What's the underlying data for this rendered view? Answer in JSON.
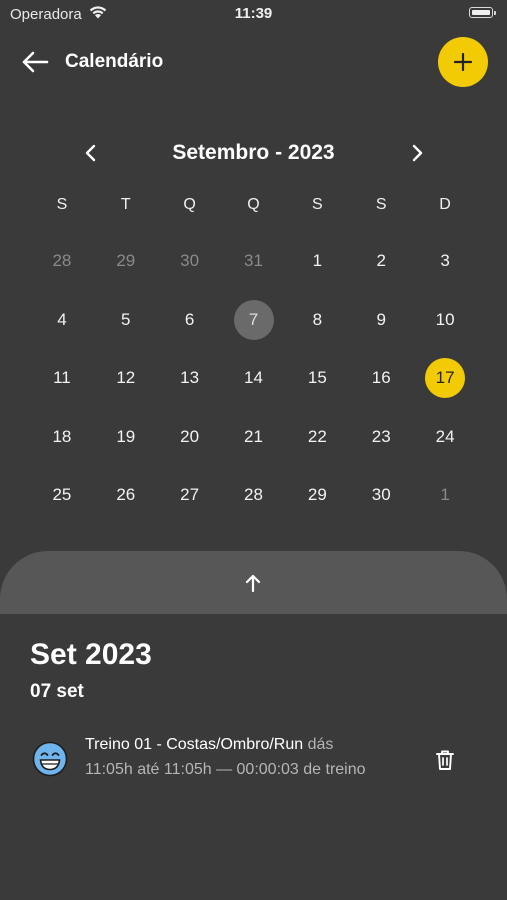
{
  "status_bar": {
    "carrier": "Operadora",
    "time": "11:39"
  },
  "header": {
    "title": "Calendário"
  },
  "calendar": {
    "month_label": "Setembro - 2023",
    "weekdays": [
      "S",
      "T",
      "Q",
      "Q",
      "S",
      "S",
      "D"
    ],
    "weeks": [
      [
        {
          "day": "28",
          "muted": true
        },
        {
          "day": "29",
          "muted": true
        },
        {
          "day": "30",
          "muted": true
        },
        {
          "day": "31",
          "muted": true
        },
        {
          "day": "1"
        },
        {
          "day": "2"
        },
        {
          "day": "3"
        }
      ],
      [
        {
          "day": "4"
        },
        {
          "day": "5"
        },
        {
          "day": "6"
        },
        {
          "day": "7",
          "selected": true
        },
        {
          "day": "8"
        },
        {
          "day": "9"
        },
        {
          "day": "10"
        }
      ],
      [
        {
          "day": "11"
        },
        {
          "day": "12"
        },
        {
          "day": "13"
        },
        {
          "day": "14"
        },
        {
          "day": "15"
        },
        {
          "day": "16"
        },
        {
          "day": "17",
          "today": true
        }
      ],
      [
        {
          "day": "18"
        },
        {
          "day": "19"
        },
        {
          "day": "20"
        },
        {
          "day": "21"
        },
        {
          "day": "22"
        },
        {
          "day": "23"
        },
        {
          "day": "24"
        }
      ],
      [
        {
          "day": "25"
        },
        {
          "day": "26"
        },
        {
          "day": "27"
        },
        {
          "day": "28"
        },
        {
          "day": "29"
        },
        {
          "day": "30"
        },
        {
          "day": "1",
          "muted": true
        }
      ]
    ]
  },
  "sheet": {
    "title": "Set 2023",
    "subtitle": "07 set",
    "entries": [
      {
        "icon": "grinning-face-emoji",
        "name": "Treino 01 - Costas/Ombro/Run",
        "suffix": "dás",
        "details": "11:05h até 11:05h — 00:00:03 de treino"
      }
    ]
  },
  "colors": {
    "accent": "#f2cb05",
    "background": "#3a3a3a",
    "sheet_handle": "#575757",
    "selected_day": "#6a6a6a"
  },
  "icons": [
    "wifi-icon",
    "battery-icon",
    "back-arrow-icon",
    "plus-icon",
    "chevron-left-icon",
    "chevron-right-icon",
    "arrow-up-icon",
    "grinning-face-icon",
    "trash-icon"
  ]
}
